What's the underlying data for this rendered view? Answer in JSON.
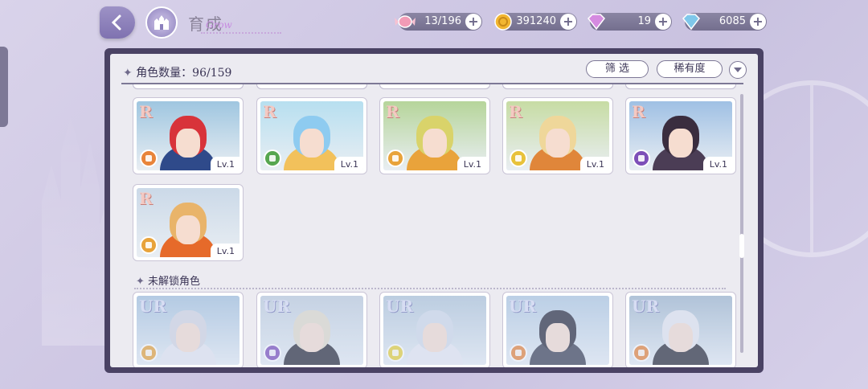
{
  "header": {
    "title": "育成",
    "title_script": "Grow"
  },
  "resources": [
    {
      "name": "candy",
      "icon": "candy-icon",
      "value": "13/196",
      "color": "#e88aa6"
    },
    {
      "name": "coins",
      "icon": "coin-icon",
      "value": "391240",
      "color": "#f2b632"
    },
    {
      "name": "pink-gem",
      "icon": "pink-gem-icon",
      "value": "19",
      "color": "#d58be0"
    },
    {
      "name": "blue-gem",
      "icon": "blue-gem-icon",
      "value": "6085",
      "color": "#7fc7ea"
    }
  ],
  "panel": {
    "count_label": "角色数量：96/159",
    "filter_label": "筛 选",
    "rarity_label": "稀有度"
  },
  "owned_cards": [
    {
      "rarity": "R",
      "level": "Lv.1",
      "element_color": "#e8843a",
      "hair": "#d8333a",
      "outfit": "#2f4a8a",
      "bg": "#9fc6e0"
    },
    {
      "rarity": "R",
      "level": "Lv.1",
      "element_color": "#56a64f",
      "hair": "#8ecbf0",
      "outfit": "#f2c15b",
      "bg": "#b7dff0"
    },
    {
      "rarity": "R",
      "level": "Lv.1",
      "element_color": "#e8a33a",
      "hair": "#d9d36a",
      "outfit": "#e9a33b",
      "bg": "#b6d59a"
    },
    {
      "rarity": "R",
      "level": "Lv.1",
      "element_color": "#e8c23a",
      "hair": "#efd79a",
      "outfit": "#e0863a",
      "bg": "#c7dca4"
    },
    {
      "rarity": "R",
      "level": "Lv.1",
      "element_color": "#7d4fb8",
      "hair": "#3a2d3f",
      "outfit": "#4b3d55",
      "bg": "#9fc0e4"
    },
    {
      "rarity": "R",
      "level": "Lv.1",
      "element_color": "#e8a33a",
      "hair": "#e9b46a",
      "outfit": "#e66a2a",
      "bg": "#cbd9e8"
    }
  ],
  "locked_section_label": "未解锁角色",
  "locked_cards": [
    {
      "rarity": "UR",
      "element_color": "#e8a33a",
      "hair": "#d8d8e0",
      "outfit": "#e8e8f0",
      "bg": "#a9c4dc"
    },
    {
      "rarity": "UR",
      "element_color": "#7d4fb8",
      "hair": "#e4dcc9",
      "outfit": "#2a2a36",
      "bg": "#c4d0dc"
    },
    {
      "rarity": "UR",
      "element_color": "#e8d23a",
      "hair": "#d4dce8",
      "outfit": "#eaeaf2",
      "bg": "#b5c8d8"
    },
    {
      "rarity": "UR",
      "element_color": "#e8843a",
      "hair": "#2a2a3a",
      "outfit": "#3c4052",
      "bg": "#b4cbe0"
    },
    {
      "rarity": "UR",
      "element_color": "#e8843a",
      "hair": "#e8e8ee",
      "outfit": "#2c2c36",
      "bg": "#a4b9cc"
    }
  ]
}
